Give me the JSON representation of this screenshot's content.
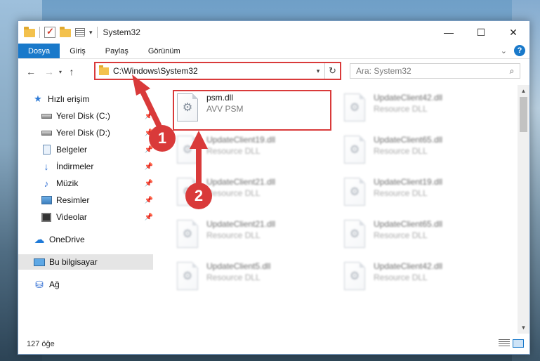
{
  "window": {
    "title": "System32",
    "controls": {
      "minimize": "—",
      "maximize": "☐",
      "close": "✕"
    }
  },
  "ribbon": {
    "tabs": [
      {
        "label": "Dosya",
        "active": true
      },
      {
        "label": "Giriş"
      },
      {
        "label": "Paylaş"
      },
      {
        "label": "Görünüm"
      }
    ],
    "help": "?"
  },
  "address": {
    "path": "C:\\Windows\\System32",
    "search_placeholder": "Ara: System32"
  },
  "sidebar": {
    "items": [
      {
        "label": "Hızlı erişim",
        "icon": "star-icon"
      },
      {
        "label": "Yerel Disk (C:)",
        "icon": "drive-icon",
        "pinned": true
      },
      {
        "label": "Yerel Disk (D:)",
        "icon": "drive-icon",
        "pinned": true
      },
      {
        "label": "Belgeler",
        "icon": "documents-icon",
        "pinned": true
      },
      {
        "label": "İndirmeler",
        "icon": "downloads-icon",
        "pinned": true
      },
      {
        "label": "Müzik",
        "icon": "music-icon",
        "pinned": true
      },
      {
        "label": "Resimler",
        "icon": "pictures-icon",
        "pinned": true
      },
      {
        "label": "Videolar",
        "icon": "videos-icon",
        "pinned": true
      },
      {
        "label": "OneDrive",
        "icon": "cloud-icon"
      },
      {
        "label": "Bu bilgisayar",
        "icon": "computer-icon",
        "selected": true
      },
      {
        "label": "Ağ",
        "icon": "network-icon"
      }
    ]
  },
  "files": [
    {
      "name": "psm.dll",
      "type": "AVV PSM",
      "highlighted": true
    },
    {
      "name": "UpdateClient42.dll",
      "type": "Resource DLL"
    },
    {
      "name": "",
      "type": "Resource DLL"
    },
    {
      "name": "UpdateClient65.dll",
      "type": "Resource DLL"
    },
    {
      "name": "UpdateClient21.dll",
      "type": "Resource DLL"
    },
    {
      "name": "UpdateClient19.dll",
      "type": "Resource DLL"
    },
    {
      "name": "UpdateClient21.dll",
      "type": "Resource DLL"
    },
    {
      "name": "UpdateClient65.dll",
      "type": "Resource DLL"
    },
    {
      "name": "UpdateClient5.dll",
      "type": "Resource DLL"
    },
    {
      "name": "UpdateClient42.dll",
      "type": "Resource DLL"
    }
  ],
  "files_left_row2_name": "UpdateClient19.dll",
  "status": {
    "item_count": "127 öğe"
  },
  "annotations": {
    "step1": "1",
    "step2": "2"
  },
  "colors": {
    "accent": "#1979ca",
    "annotation": "#d93a3a"
  }
}
